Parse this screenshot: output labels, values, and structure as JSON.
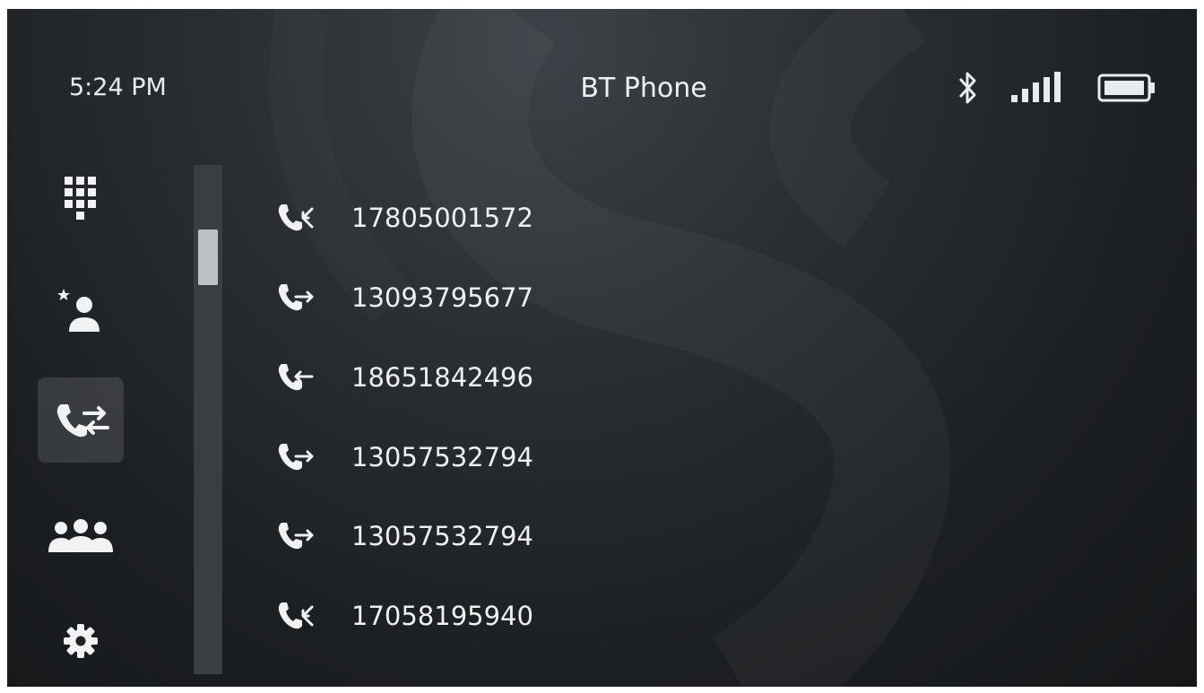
{
  "status_bar": {
    "time": "5:24 PM",
    "title": "BT Phone",
    "icons": [
      "bluetooth-icon",
      "signal-icon",
      "battery-icon"
    ]
  },
  "sidebar": {
    "items": [
      {
        "icon": "dialpad-icon",
        "active": false
      },
      {
        "icon": "favorite-contact-icon",
        "active": false
      },
      {
        "icon": "call-log-icon",
        "active": true
      },
      {
        "icon": "contacts-icon",
        "active": false
      },
      {
        "icon": "settings-icon",
        "active": false
      }
    ]
  },
  "scrollbar": {
    "position": 0.15
  },
  "calls": [
    {
      "type": "missed",
      "icon": "missed-call-icon",
      "number": "17805001572"
    },
    {
      "type": "outgoing",
      "icon": "outgoing-call-icon",
      "number": "13093795677"
    },
    {
      "type": "incoming",
      "icon": "incoming-call-icon",
      "number": "18651842496"
    },
    {
      "type": "outgoing",
      "icon": "outgoing-call-icon",
      "number": "13057532794"
    },
    {
      "type": "outgoing",
      "icon": "outgoing-call-icon",
      "number": "13057532794"
    },
    {
      "type": "missed",
      "icon": "missed-call-icon",
      "number": "17058195940"
    }
  ],
  "colors": {
    "text": "#eef0f2",
    "background": "#1c1f22",
    "active_item": "#44484c"
  }
}
